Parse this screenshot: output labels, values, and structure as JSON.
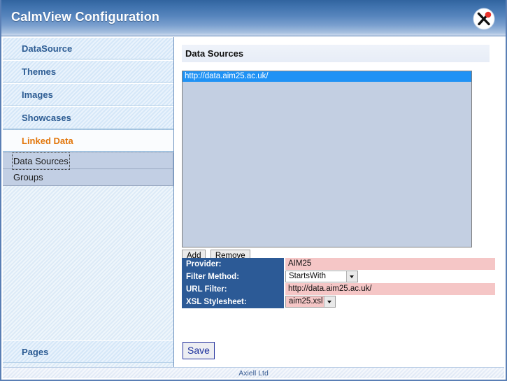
{
  "window": {
    "title": "CalmView Configuration",
    "logo_icon": "axiell-logo-icon"
  },
  "sidebar": {
    "items": [
      {
        "label": "DataSource",
        "active": false
      },
      {
        "label": "Themes",
        "active": false
      },
      {
        "label": "Images",
        "active": false
      },
      {
        "label": "Showcases",
        "active": false
      },
      {
        "label": "Linked Data",
        "active": true
      }
    ],
    "submenu": [
      {
        "label": "Data Sources",
        "focused": true
      },
      {
        "label": "Groups",
        "focused": false
      }
    ],
    "bottom_item": {
      "label": "Pages"
    }
  },
  "main": {
    "section_title": "Data Sources",
    "listbox": {
      "options": [
        {
          "value": "http://data.aim25.ac.uk/",
          "selected": true
        }
      ]
    },
    "buttons": {
      "add_label": "Add",
      "remove_label": "Remove",
      "save_label": "Save"
    },
    "form": {
      "rows": [
        {
          "label": "Provider:",
          "type": "text",
          "value": "AIM25"
        },
        {
          "label": "Filter Method:",
          "type": "select",
          "value": "StartsWith"
        },
        {
          "label": "URL Filter:",
          "type": "text",
          "value": "http://data.aim25.ac.uk/"
        },
        {
          "label": "XSL Stylesheet:",
          "type": "select",
          "value": "aim25.xsl"
        }
      ]
    }
  },
  "footer": {
    "text": "Axiell Ltd"
  },
  "colors": {
    "titlebar_top": "#31649f",
    "titlebar_bottom": "#cfdcef",
    "active_nav_text": "#e2770c",
    "nav_text": "#2d5c93",
    "label_cell_bg": "#2c5a96",
    "field_bg": "#f5c6c6",
    "selection_bg": "#1f92f5",
    "listbox_bg": "#c3cfe2",
    "save_border": "#22309c"
  }
}
